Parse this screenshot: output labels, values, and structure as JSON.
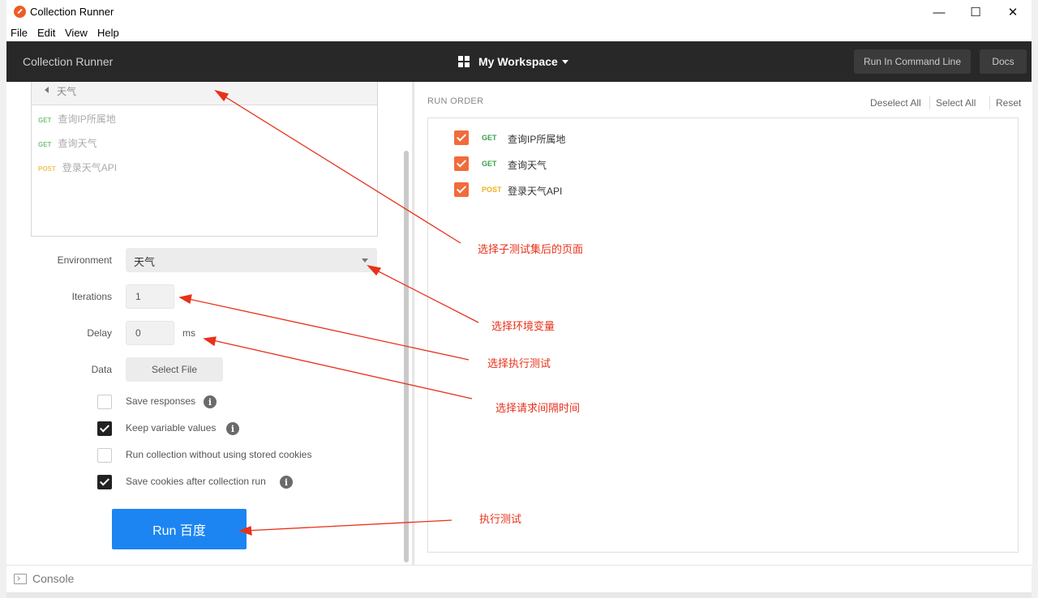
{
  "window": {
    "title": "Collection Runner",
    "minimize": "—",
    "maximize": "☐",
    "close": "✕"
  },
  "menu": [
    "File",
    "Edit",
    "View",
    "Help"
  ],
  "header": {
    "title": "Collection Runner",
    "workspace": "My Workspace",
    "run_cli": "Run In Command Line",
    "docs": "Docs"
  },
  "collection": {
    "folder": "天气",
    "requests": [
      {
        "method": "GET",
        "name": "查询IP所属地"
      },
      {
        "method": "GET",
        "name": "查询天气"
      },
      {
        "method": "POST",
        "name": "登录天气API"
      }
    ]
  },
  "form": {
    "environment_label": "Environment",
    "environment_value": "天气",
    "iterations_label": "Iterations",
    "iterations_value": "1",
    "delay_label": "Delay",
    "delay_value": "0",
    "delay_unit": "ms",
    "data_label": "Data",
    "select_file": "Select File"
  },
  "options": [
    {
      "label": "Save responses",
      "checked": false,
      "info": true
    },
    {
      "label": "Keep variable values",
      "checked": true,
      "info": true
    },
    {
      "label": "Run collection without using stored cookies",
      "checked": false,
      "info": false
    },
    {
      "label": "Save cookies after collection run",
      "checked": true,
      "info": true
    }
  ],
  "info_glyph": "i",
  "run_button": "Run 百度",
  "run_order": {
    "title": "RUN ORDER",
    "deselect_all": "Deselect All",
    "select_all": "Select All",
    "reset": "Reset",
    "items": [
      {
        "method": "GET",
        "name": "查询IP所属地",
        "checked": true
      },
      {
        "method": "GET",
        "name": "查询天气",
        "checked": true
      },
      {
        "method": "POST",
        "name": "登录天气API",
        "checked": true
      }
    ]
  },
  "console": "Console",
  "annotations": {
    "sub_collection": "选择子测试集后的页面",
    "environment": "选择环境变量",
    "iterations": "选择执行测试",
    "delay": "选择请求间隔时间",
    "run": "执行测试"
  },
  "colors": {
    "accent_blue": "#1c85f2",
    "orange": "#f26b3a",
    "annotation_red": "#e8311a",
    "header_dark": "#282828"
  }
}
